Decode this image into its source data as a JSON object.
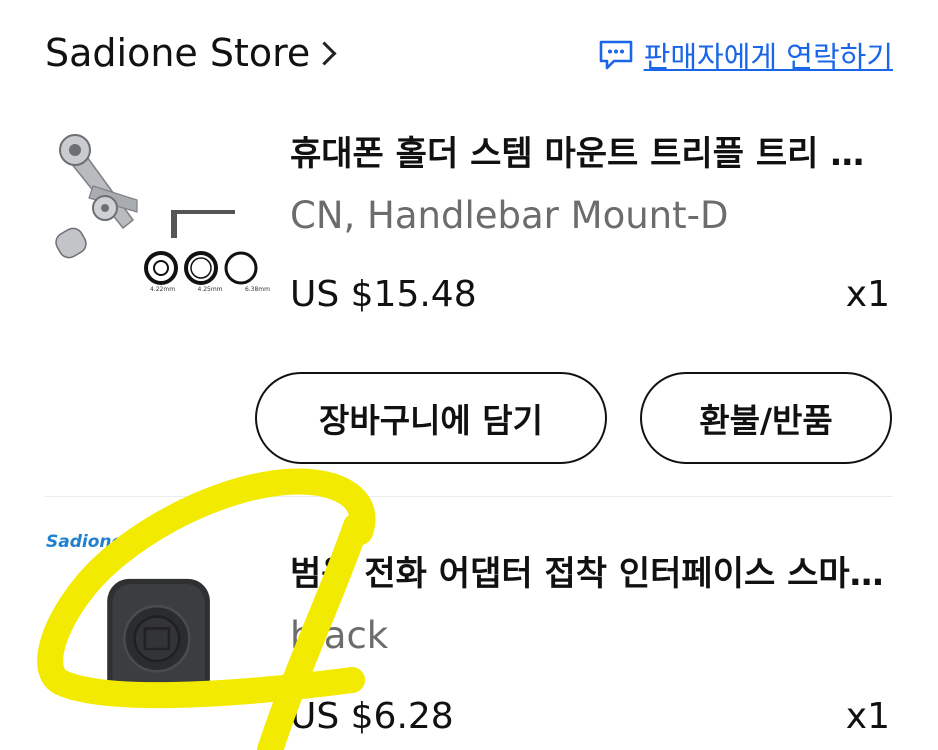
{
  "store": {
    "name": "Sadione Store",
    "contact_label": "판매자에게 연락하기"
  },
  "items": [
    {
      "title": "휴대폰 홀더 스템 마운트 트리플 트리 에어밴 마운트",
      "variant": "CN, Handlebar Mount-D",
      "price": "US $15.48",
      "quantity": "x1",
      "thumb_labels": [
        "4.22mm",
        "4.25mm",
        "6.38mm"
      ]
    },
    {
      "title": "범용 전화 어댑터 접착 인터페이스 스마트폰 마운트",
      "variant": "black",
      "price": "US $6.28",
      "quantity": "x1",
      "brand_label": "Sadione"
    }
  ],
  "actions": {
    "add_to_cart": "장바구니에 담기",
    "refund_return": "환불/반품"
  },
  "colors": {
    "link_blue": "#1a66e8",
    "scribble_yellow": "#f2ea00"
  }
}
